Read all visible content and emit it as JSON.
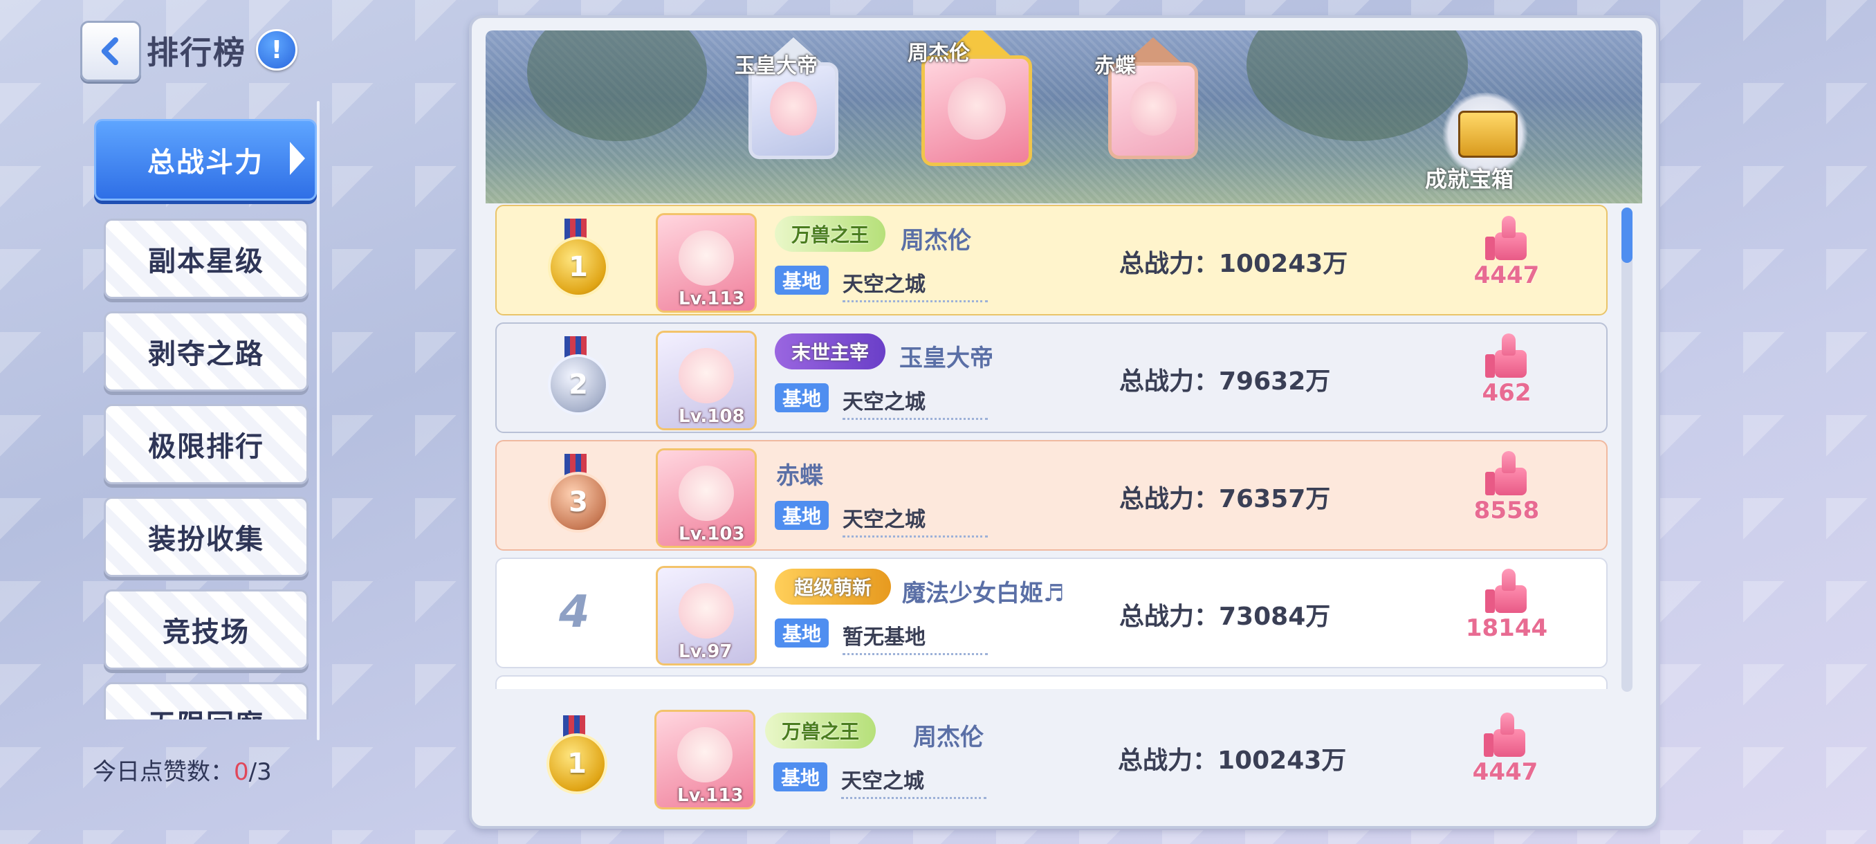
{
  "header": {
    "title": "排行榜",
    "info": "!"
  },
  "tabs": [
    {
      "label": "总战斗力",
      "active": true
    },
    {
      "label": "副本星级"
    },
    {
      "label": "剥夺之路"
    },
    {
      "label": "极限排行"
    },
    {
      "label": "装扮收集"
    },
    {
      "label": "竞技场"
    },
    {
      "label": "无限回廊"
    }
  ],
  "likes_today": {
    "label": "今日点赞数：",
    "used": "0",
    "total": "/3"
  },
  "podium": [
    {
      "rank": 2,
      "name": "玉皇大帝"
    },
    {
      "rank": 1,
      "name": "周杰伦"
    },
    {
      "rank": 3,
      "name": "赤蝶"
    }
  ],
  "chest_label": "成就宝箱",
  "rows": [
    {
      "rank": "1",
      "level": "Lv.113",
      "badge": "万兽之王",
      "name": "周杰伦",
      "base_tag": "基地",
      "base": "天空之城",
      "power": "总战力：100243万",
      "likes": "4447"
    },
    {
      "rank": "2",
      "level": "Lv.108",
      "badge": "末世主宰",
      "name": "玉皇大帝",
      "base_tag": "基地",
      "base": "天空之城",
      "power": "总战力：79632万",
      "likes": "462"
    },
    {
      "rank": "3",
      "level": "Lv.103",
      "badge": "",
      "name": "赤蝶",
      "base_tag": "基地",
      "base": "天空之城",
      "power": "总战力：76357万",
      "likes": "8558"
    },
    {
      "rank": "4",
      "level": "Lv.97",
      "badge": "超级萌新",
      "name": "魔法少女白姬♬",
      "base_tag": "基地",
      "base": "暂无基地",
      "power": "总战力：73084万",
      "likes": "18144"
    }
  ],
  "my_row": {
    "rank": "1",
    "level": "Lv.113",
    "badge": "万兽之王",
    "name": "周杰伦",
    "base_tag": "基地",
    "base": "天空之城",
    "power": "总战力：100243万",
    "likes": "4447"
  },
  "colors": {
    "accent": "#4f8ef0",
    "like": "#e86b92",
    "gold": "#e0a516"
  }
}
